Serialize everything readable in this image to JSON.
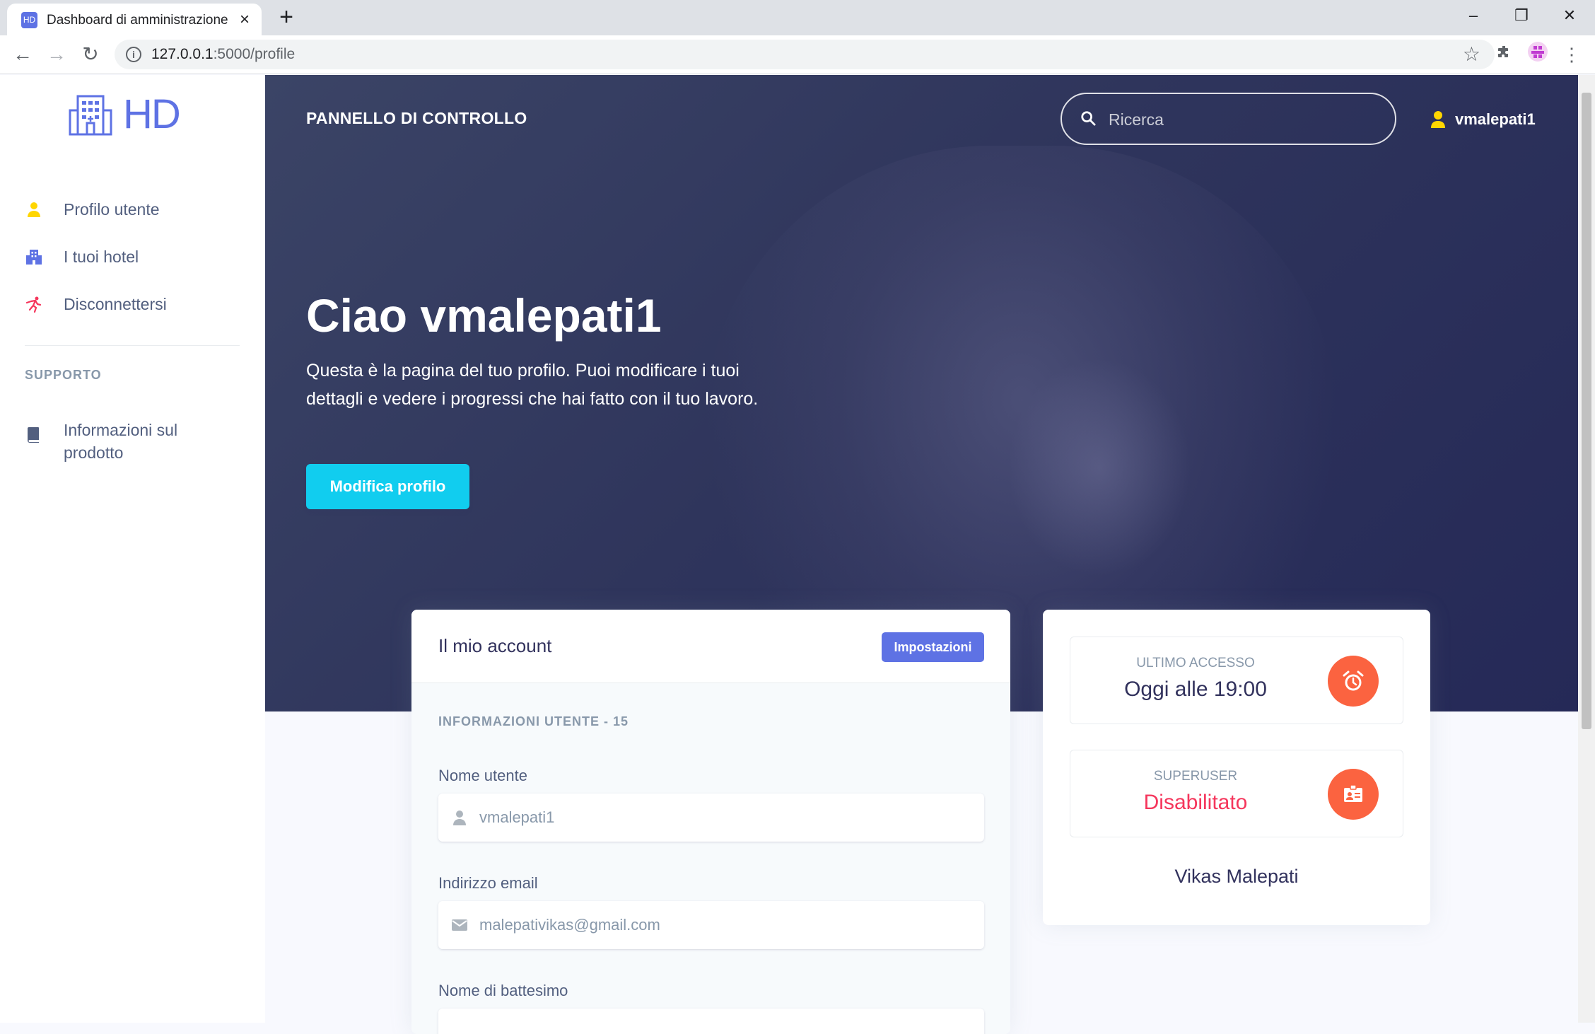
{
  "browser": {
    "tab_title": "Dashboard di amministrazione di",
    "tab_favicon": "HD",
    "url_host": "127.0.0.1",
    "url_path": ":5000/profile"
  },
  "sidebar": {
    "logo_text": "HD",
    "items": [
      {
        "label": "Profilo utente",
        "icon": "user-icon",
        "color": "#ffd600"
      },
      {
        "label": "I tuoi hotel",
        "icon": "building-icon",
        "color": "#5e72e4"
      },
      {
        "label": "Disconnettersi",
        "icon": "running-icon",
        "color": "#f5365c"
      }
    ],
    "support_heading": "SUPPORTO",
    "support_items": [
      {
        "label": "Informazioni sul prodotto",
        "icon": "book-icon"
      }
    ]
  },
  "header": {
    "brand": "PANNELLO DI CONTROLLO",
    "search_placeholder": "Ricerca",
    "username": "vmalepati1"
  },
  "hero": {
    "greeting": "Ciao vmalepati1",
    "description": "Questa è la pagina del tuo profilo. Puoi modificare i tuoi dettagli e vedere i progressi che hai fatto con il tuo lavoro.",
    "edit_button": "Modifica profilo"
  },
  "account": {
    "title": "Il mio account",
    "settings_button": "Impostazioni",
    "section_heading": "INFORMAZIONI UTENTE - 15",
    "fields": [
      {
        "label": "Nome utente",
        "value": "vmalepati1",
        "icon": "user-icon"
      },
      {
        "label": "Indirizzo email",
        "value": "malepativikas@gmail.com",
        "icon": "envelope-icon"
      },
      {
        "label": "Nome di battesimo",
        "value": "",
        "icon": ""
      }
    ]
  },
  "stats": {
    "last_access_label": "ULTIMO ACCESSO",
    "last_access_value": "Oggi alle 19:00",
    "superuser_label": "SUPERUSER",
    "superuser_value": "Disabilitato",
    "superuser_color": "#f5365c",
    "full_name": "Vikas Malepati"
  },
  "colors": {
    "primary": "#5e72e4",
    "info": "#11cdef",
    "warning": "#fb6340",
    "hero": "#2f355c"
  }
}
